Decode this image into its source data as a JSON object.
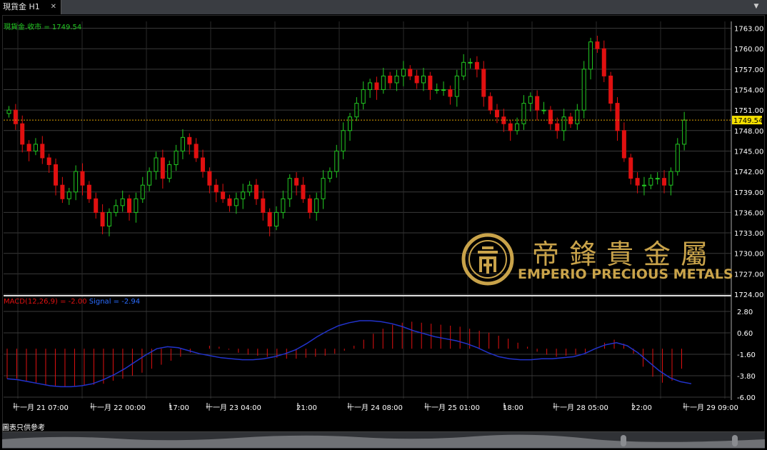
{
  "tab": {
    "title": "現貨金 H1",
    "close": "✕"
  },
  "menu_arrow": "▼",
  "price_label": "現貨金.收市 = 1749.54",
  "macd": {
    "label": "MACD(12,26,9) = -2.00",
    "signal": "Signal = -2.94"
  },
  "disclaimer": "圖表只供參考",
  "current_price": "1749.54",
  "logo": {
    "cjk": "帝鋒貴金屬",
    "name": "EMPERIO PRECIOUS METALS"
  },
  "colors": {
    "up": "#22c922",
    "down": "#e01010",
    "signal": "#2233cc",
    "current": "#e0a000",
    "logo": "#c9a34a"
  },
  "y_axis": [
    "1763.00",
    "1760.00",
    "1757.00",
    "1754.00",
    "1751.00",
    "1748.00",
    "1745.00",
    "1742.00",
    "1739.00",
    "1736.00",
    "1733.00",
    "1730.00",
    "1727.00",
    "1724.00"
  ],
  "macd_axis": [
    "2.80",
    "0.60",
    "-1.60",
    "-3.80",
    "-6.00"
  ],
  "x_axis": [
    "十一月 21 07:00",
    "十一月 22 00:00",
    "17:00",
    "十一月 23 04:00",
    "21:00",
    "十一月 24 08:00",
    "十一月 25 01:00",
    "18:00",
    "十一月 28 05:00",
    "22:00",
    "十一月 29 09:00"
  ],
  "chart_data": {
    "type": "candlestick",
    "title": "現貨金 H1",
    "ylim": [
      1724,
      1764
    ],
    "close_last": 1749.54,
    "closes": [
      1751,
      1749,
      1746,
      1745,
      1746,
      1744,
      1743,
      1740,
      1738,
      1739,
      1742,
      1740,
      1738,
      1736,
      1734,
      1736,
      1737,
      1738,
      1736,
      1738,
      1740,
      1742,
      1744,
      1741,
      1743,
      1745,
      1747,
      1746,
      1744,
      1742,
      1740,
      1739,
      1738,
      1737,
      1738,
      1739,
      1740,
      1738,
      1736,
      1734,
      1736,
      1738,
      1741,
      1740,
      1738,
      1736,
      1738,
      1741,
      1742,
      1745,
      1748,
      1750,
      1752,
      1754,
      1755,
      1754,
      1756,
      1755,
      1756,
      1757,
      1756,
      1755,
      1756,
      1754,
      1754,
      1754,
      1753,
      1756,
      1758,
      1758,
      1757,
      1753,
      1751,
      1750,
      1749,
      1748,
      1749,
      1752,
      1753,
      1751,
      1751,
      1749,
      1748,
      1750,
      1749,
      1751,
      1757,
      1761,
      1760,
      1756,
      1752,
      1748,
      1744,
      1741,
      1740,
      1740,
      1741,
      1741,
      1740,
      1742,
      1746,
      1749.54
    ],
    "macd_hist": [
      -3,
      -3,
      -3.2,
      -3.4,
      -3.6,
      -3.7,
      -3.8,
      -3.8,
      -3.7,
      -3.6,
      -3.5,
      -3.2,
      -3,
      -2.7,
      -2.4,
      -2,
      -1.6,
      -1.2,
      -0.8,
      -0.4,
      0,
      0.3,
      0.2,
      -0.1,
      -0.4,
      -0.6,
      -0.7,
      -0.8,
      -0.9,
      -1,
      -1,
      -0.9,
      -0.8,
      -0.7,
      -0.5,
      -0.2,
      0.3,
      0.9,
      1.5,
      2,
      2.4,
      2.6,
      2.7,
      2.6,
      2.5,
      2.4,
      2.3,
      2.2,
      2,
      1.8,
      1.6,
      1.3,
      1,
      0.6,
      0.2,
      -0.3,
      -0.6,
      -0.8,
      -0.7,
      -0.6,
      -0.4,
      0,
      0.6,
      0.9,
      0.5,
      -0.5,
      -1.8,
      -2.8,
      -3.4,
      -3.2,
      -2
    ],
    "macd_signal": [
      -3,
      -3.1,
      -3.3,
      -3.5,
      -3.7,
      -3.8,
      -3.8,
      -3.7,
      -3.5,
      -3.1,
      -2.6,
      -2,
      -1.3,
      -0.6,
      0,
      0.2,
      0.1,
      -0.2,
      -0.5,
      -0.7,
      -0.9,
      -1,
      -1.1,
      -1.1,
      -1,
      -0.8,
      -0.5,
      -0.1,
      0.5,
      1.2,
      1.8,
      2.3,
      2.6,
      2.8,
      2.8,
      2.7,
      2.5,
      2.2,
      1.8,
      1.5,
      1.2,
      1,
      0.8,
      0.5,
      0.1,
      -0.4,
      -0.8,
      -1,
      -1.1,
      -1.1,
      -1,
      -1,
      -0.9,
      -0.8,
      -0.5,
      0,
      0.4,
      0.6,
      0.3,
      -0.4,
      -1.3,
      -2.2,
      -2.9,
      -3.3,
      -3.5
    ]
  }
}
